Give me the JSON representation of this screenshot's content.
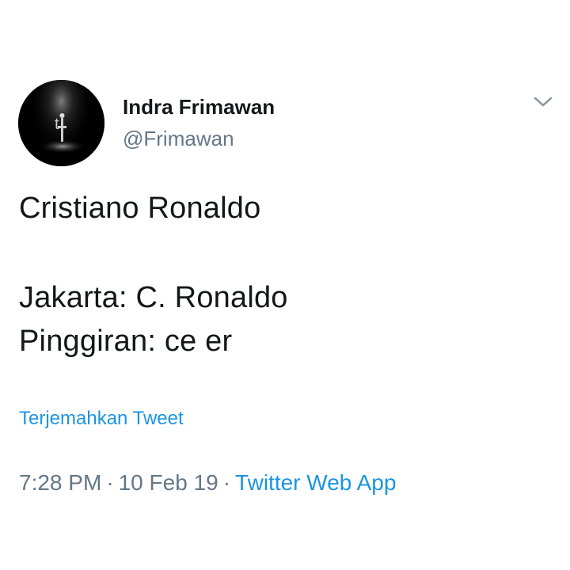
{
  "author": {
    "display_name": "Indra Frimawan",
    "handle": "@Frimawan"
  },
  "icons": {
    "menu": "chevron-down-icon"
  },
  "tweet": {
    "lines": [
      "Cristiano Ronaldo",
      "Jakarta: C. Ronaldo",
      "Pinggiran: ce er"
    ],
    "translate_label": "Terjemahkan Tweet"
  },
  "meta": {
    "time": "7:28 PM",
    "separator": "·",
    "date": "10 Feb 19",
    "source": "Twitter Web App"
  },
  "colors": {
    "link": "#1b95e0",
    "secondary_text": "#657786",
    "primary_text": "#14171a"
  }
}
